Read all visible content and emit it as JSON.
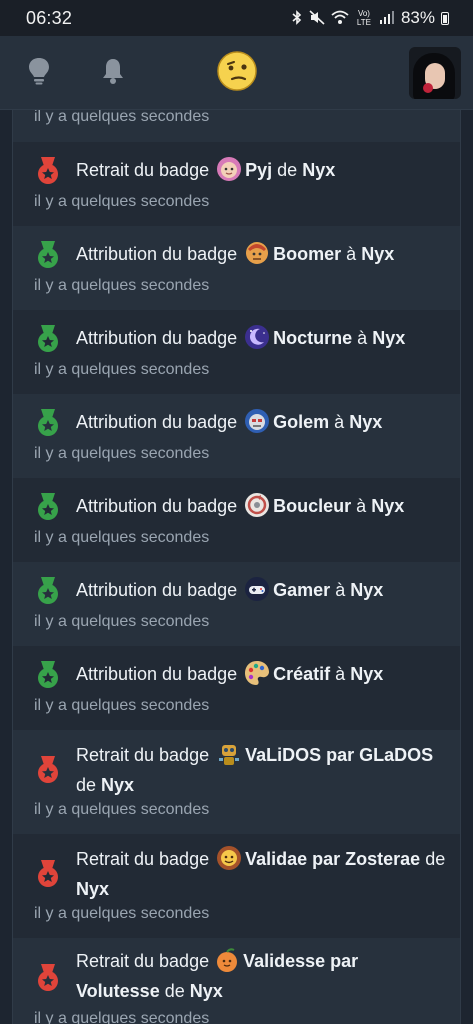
{
  "status_bar": {
    "time": "06:32",
    "network": "Vo) LTE",
    "battery": "83%"
  },
  "header": {
    "icons": [
      "lightbulb-icon",
      "bell-icon",
      "smiley-icon"
    ],
    "avatar_alt": "profile avatar"
  },
  "feed": {
    "items": [
      {
        "timestamp": "il y a quelques secondes"
      },
      {
        "type": "removal",
        "prefix": "Retrait du badge",
        "badge": "Pyj",
        "joiner": "de",
        "user": "Nyx",
        "badge_icon": "baby-face-icon",
        "timestamp": "il y a quelques secondes"
      },
      {
        "type": "grant",
        "prefix": "Attribution du badge",
        "badge": "Boomer",
        "joiner": "à",
        "user": "Nyx",
        "badge_icon": "boomer-icon",
        "timestamp": "il y a quelques secondes"
      },
      {
        "type": "grant",
        "prefix": "Attribution du badge",
        "badge": "Nocturne",
        "joiner": "à",
        "user": "Nyx",
        "badge_icon": "moon-icon",
        "timestamp": "il y a quelques secondes"
      },
      {
        "type": "grant",
        "prefix": "Attribution du badge",
        "badge": "Golem",
        "joiner": "à",
        "user": "Nyx",
        "badge_icon": "golem-icon",
        "timestamp": "il y a quelques secondes"
      },
      {
        "type": "grant",
        "prefix": "Attribution du badge",
        "badge": "Boucleur",
        "joiner": "à",
        "user": "Nyx",
        "badge_icon": "loop-icon",
        "timestamp": "il y a quelques secondes"
      },
      {
        "type": "grant",
        "prefix": "Attribution du badge",
        "badge": "Gamer",
        "joiner": "à",
        "user": "Nyx",
        "badge_icon": "gamepad-icon",
        "timestamp": "il y a quelques secondes"
      },
      {
        "type": "grant",
        "prefix": "Attribution du badge",
        "badge": "Créatif",
        "joiner": "à",
        "user": "Nyx",
        "badge_icon": "palette-icon",
        "timestamp": "il y a quelques secondes"
      },
      {
        "type": "removal",
        "prefix": "Retrait du badge",
        "badge": "VaLiDOS par GLaDOS",
        "joiner": "de",
        "user": "Nyx",
        "badge_icon": "robot-icon",
        "timestamp": "il y a quelques secondes"
      },
      {
        "type": "removal",
        "prefix": "Retrait du badge",
        "badge": "Validae par Zosterae",
        "joiner": "de",
        "user": "Nyx",
        "badge_icon": "sun-face-icon",
        "timestamp": "il y a quelques secondes"
      },
      {
        "type": "removal",
        "prefix": "Retrait du badge",
        "badge": "Validesse par Volutesse",
        "joiner": "de",
        "user": "Nyx",
        "badge_icon": "peach-icon",
        "timestamp": "il y a quelques secondes"
      }
    ]
  },
  "colors": {
    "grant_medal": "#37a24a",
    "removal_medal": "#e0443a",
    "background": "#222a35",
    "header": "#27313d",
    "timestamp": "#9aa5b1"
  }
}
